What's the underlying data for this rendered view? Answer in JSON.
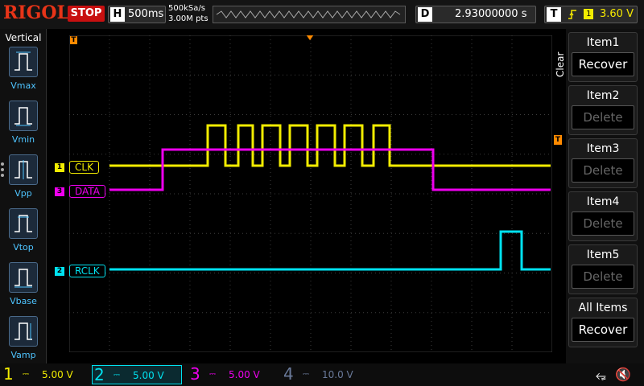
{
  "topbar": {
    "brand": "RIGOL",
    "run_state": "STOP",
    "timebase_letter": "H",
    "timebase_value": "500ms",
    "sample_rate": "500kSa/s",
    "memory_depth": "3.00M pts",
    "delay_letter": "D",
    "delay_value": "2.93000000 s",
    "trigger_letter": "T",
    "trigger_edge_icon": "rising-edge-icon",
    "trigger_source": "1",
    "trigger_level": "3.60 V"
  },
  "left_menu": {
    "title": "Vertical",
    "items": [
      {
        "label": "Vmax",
        "icon": "vmax-icon"
      },
      {
        "label": "Vmin",
        "icon": "vmin-icon"
      },
      {
        "label": "Vpp",
        "icon": "vpp-icon"
      },
      {
        "label": "Vtop",
        "icon": "vtop-icon"
      },
      {
        "label": "Vbase",
        "icon": "vbase-icon"
      },
      {
        "label": "Vamp",
        "icon": "vamp-icon"
      }
    ]
  },
  "channels": {
    "clk": {
      "label": "CLK",
      "num": "1",
      "color": "#f2ec00"
    },
    "data": {
      "label": "DATA",
      "num": "3",
      "color": "#ee00ee"
    },
    "rclk": {
      "label": "RCLK",
      "num": "2",
      "color": "#00e2f0"
    }
  },
  "right_menu": {
    "clear_label": "Clear",
    "items": [
      {
        "label": "Item1",
        "button": "Recover",
        "enabled": true
      },
      {
        "label": "Item2",
        "button": "Delete",
        "enabled": false
      },
      {
        "label": "Item3",
        "button": "Delete",
        "enabled": false
      },
      {
        "label": "Item4",
        "button": "Delete",
        "enabled": false
      },
      {
        "label": "Item5",
        "button": "Delete",
        "enabled": false
      },
      {
        "label": "All Items",
        "button": "Recover",
        "enabled": true
      }
    ]
  },
  "bottombar": {
    "ch1": {
      "num": "1",
      "scale": "5.00 V",
      "color": "#f2ec00"
    },
    "ch2": {
      "num": "2",
      "scale": "5.00 V",
      "color": "#00e2f0"
    },
    "ch3": {
      "num": "3",
      "scale": "5.00 V",
      "color": "#ee00ee"
    },
    "ch4": {
      "num": "4",
      "scale": "10.0 V",
      "color": "#6a7a9a"
    },
    "usb_icon": "usb-icon",
    "speaker_icon": "speaker-muted-icon"
  },
  "colors": {
    "grid": "#3c3c3c",
    "trigger_marker": "#ff8a00"
  }
}
